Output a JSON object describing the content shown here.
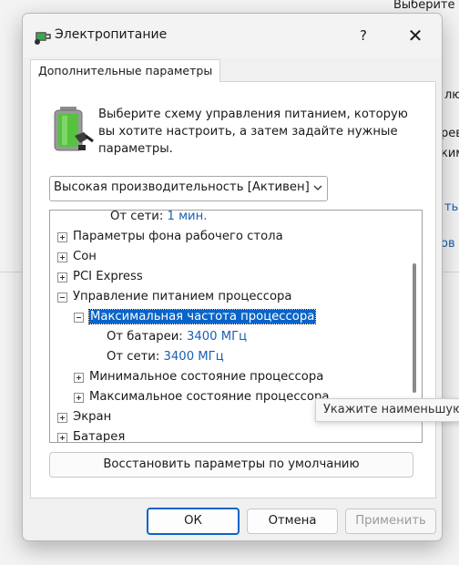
{
  "background": {
    "top_right_text": "Выберите",
    "fragments": [
      "лю",
      "рев",
      "ким",
      "ть",
      "ов"
    ]
  },
  "dialog": {
    "title": "Электропитание",
    "help_label": "?",
    "close_label": "✕",
    "tab_label": "Дополнительные параметры",
    "description": "Выберите схему управления питанием, которую вы хотите настроить, а затем задайте нужные параметры.",
    "scheme": {
      "selected": "Высокая производительность [Активен]"
    },
    "tree": {
      "row0": {
        "label": "От сети:",
        "value": "1 мин."
      },
      "row1": {
        "label": "Параметры фона рабочего стола"
      },
      "row2": {
        "label": "Сон"
      },
      "row3": {
        "label": "PCI Express"
      },
      "row4": {
        "label": "Управление питанием процессора"
      },
      "row5": {
        "label": "Максимальная частота процессора"
      },
      "row6": {
        "label": "От батареи:",
        "value": "3400 МГц"
      },
      "row7": {
        "label": "От сети:",
        "value": "3400 МГц"
      },
      "row8": {
        "label": "Минимальное состояние процессора"
      },
      "row9": {
        "label": "Максимальное состояние процессора"
      },
      "row10": {
        "label": "Экран"
      },
      "row11": {
        "label": "Батарея"
      }
    },
    "restore_label": "Восстановить параметры по умолчанию",
    "ok_label": "ОК",
    "cancel_label": "Отмена",
    "apply_label": "Применить",
    "tooltip": "Укажите наименьшую"
  }
}
